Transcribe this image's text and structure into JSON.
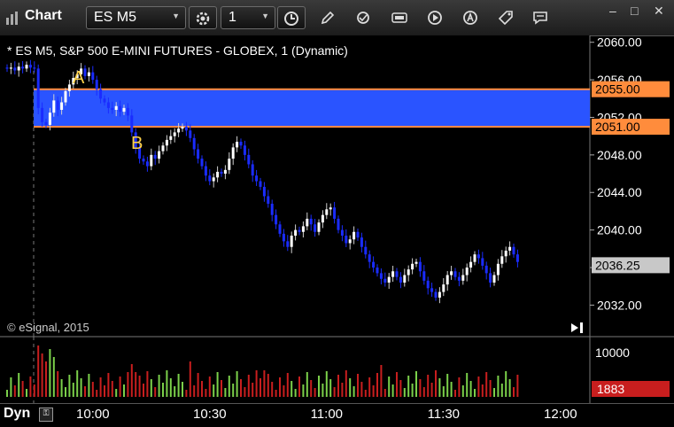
{
  "window": {
    "title": "Chart",
    "symbol": "ES M5",
    "interval": "1",
    "minimize_glyph": "–",
    "restore_glyph": "□",
    "close_glyph": "✕"
  },
  "chart": {
    "header": "* ES M5, S&P 500 E-MINI FUTURES - GLOBEX, 1 (Dynamic)",
    "copyright": "© eSignal, 2015",
    "marker_a": "A",
    "marker_b": "B",
    "price_ticks": [
      "2060.00",
      "2056.00",
      "2052.00",
      "2048.00",
      "2044.00",
      "2040.00",
      "2036.00",
      "2032.00"
    ],
    "price_tick_values": [
      2060,
      2056,
      2052,
      2048,
      2044,
      2040,
      2036,
      2032
    ],
    "zone_upper": "2055.00",
    "zone_upper_value": 2055,
    "zone_lower": "2051.00",
    "zone_lower_value": 2051,
    "last_price": "2036.25",
    "last_price_value": 2036.25,
    "volume_tick": "10000",
    "last_volume": "1883",
    "time_labels": [
      "10:00",
      "10:30",
      "11:00",
      "11:30",
      "12:00"
    ],
    "time_label_index": [
      22,
      52,
      82,
      112,
      142
    ],
    "colors": {
      "zone": "#2a54ff",
      "zone_border": "#ff8c3c",
      "up": "#ffffff",
      "down": "#1a2cff",
      "vol_up": "#7bd04a",
      "vol_down": "#c81e1e",
      "label_a_b": "#ffd24a"
    }
  },
  "bottom": {
    "mode": "Dyn",
    "icon_name": "lock-icon"
  },
  "chart_data": {
    "type": "candlestick",
    "x_unit": "5-minute bars (index)",
    "y_range": [
      2030,
      2061
    ],
    "closes": [
      2057.2,
      2057.3,
      2057.0,
      2057.4,
      2057.2,
      2057.6,
      2057.3,
      2057.2,
      2053.0,
      2051.5,
      2051.2,
      2052.5,
      2053.8,
      2052.8,
      2053.6,
      2054.8,
      2055.5,
      2056.2,
      2056.6,
      2057.2,
      2056.4,
      2056.8,
      2056.0,
      2055.0,
      2054.0,
      2053.6,
      2053.0,
      2052.8,
      2053.2,
      2052.6,
      2053.0,
      2052.2,
      2050.4,
      2048.8,
      2047.6,
      2047.3,
      2046.8,
      2048.0,
      2047.6,
      2048.4,
      2049.0,
      2049.6,
      2050.0,
      2050.4,
      2050.8,
      2051.0,
      2050.6,
      2049.8,
      2048.6,
      2047.6,
      2046.8,
      2045.8,
      2045.2,
      2045.6,
      2046.2,
      2046.0,
      2046.4,
      2047.6,
      2048.8,
      2049.4,
      2049.0,
      2048.0,
      2047.0,
      2045.8,
      2045.2,
      2044.6,
      2043.6,
      2042.8,
      2041.6,
      2040.6,
      2039.6,
      2038.8,
      2038.2,
      2039.4,
      2040.0,
      2039.8,
      2040.4,
      2041.2,
      2040.6,
      2039.8,
      2040.8,
      2041.6,
      2042.2,
      2042.4,
      2041.2,
      2040.0,
      2039.4,
      2038.6,
      2039.0,
      2039.8,
      2039.2,
      2038.2,
      2037.4,
      2036.6,
      2036.0,
      2035.4,
      2034.8,
      2034.4,
      2035.0,
      2035.6,
      2035.0,
      2034.4,
      2035.2,
      2035.8,
      2036.4,
      2036.6,
      2035.6,
      2034.6,
      2033.8,
      2033.4,
      2032.8,
      2033.4,
      2034.2,
      2035.2,
      2035.6,
      2035.0,
      2034.6,
      2035.2,
      2036.0,
      2036.6,
      2037.4,
      2037.0,
      2036.2,
      2035.4,
      2034.4,
      2035.2,
      2036.4,
      2037.2,
      2037.8,
      2038.2,
      2037.4,
      2036.6
    ],
    "series": [
      {
        "name": "ES M5",
        "values": []
      }
    ]
  }
}
